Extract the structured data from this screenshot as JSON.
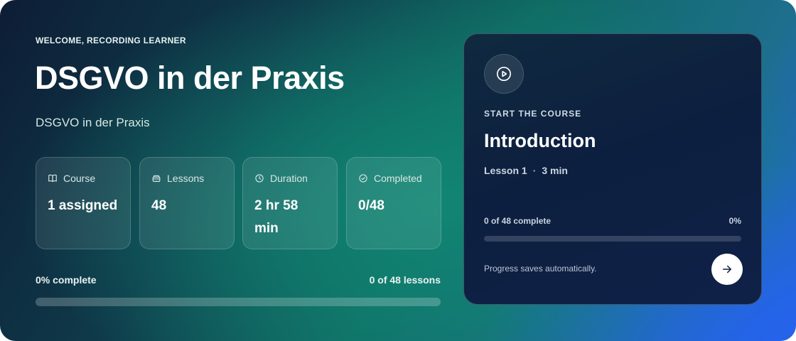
{
  "hero": {
    "eyebrow": "WELCOME, RECORDING LEARNER",
    "title": "DSGVO in der Praxis",
    "subtitle": "DSGVO in der Praxis"
  },
  "stats": [
    {
      "label": "Course",
      "value": "1 assigned",
      "icon": "book-icon"
    },
    {
      "label": "Lessons",
      "value": "48",
      "icon": "stack-icon"
    },
    {
      "label": "Duration",
      "value": "2 hr 58 min",
      "icon": "clock-icon"
    },
    {
      "label": "Completed",
      "value": "0/48",
      "icon": "check-circle-icon"
    }
  ],
  "progress": {
    "percent_label": "0% complete",
    "lessons_label": "0 of 48 lessons",
    "fraction": 0
  },
  "card": {
    "icon": "play-icon",
    "eyebrow": "START THE COURSE",
    "title": "Introduction",
    "lesson": "Lesson 1",
    "separator": "·",
    "duration": "3 min",
    "progress_label": "0 of 48 complete",
    "progress_percent": "0%",
    "progress_fraction": 0,
    "note": "Progress saves automatically.",
    "next_icon": "arrow-right-icon"
  },
  "colors": {
    "accent_blue": "#2563eb",
    "accent_teal": "#118573",
    "card_bg": "#0d1f3f"
  }
}
